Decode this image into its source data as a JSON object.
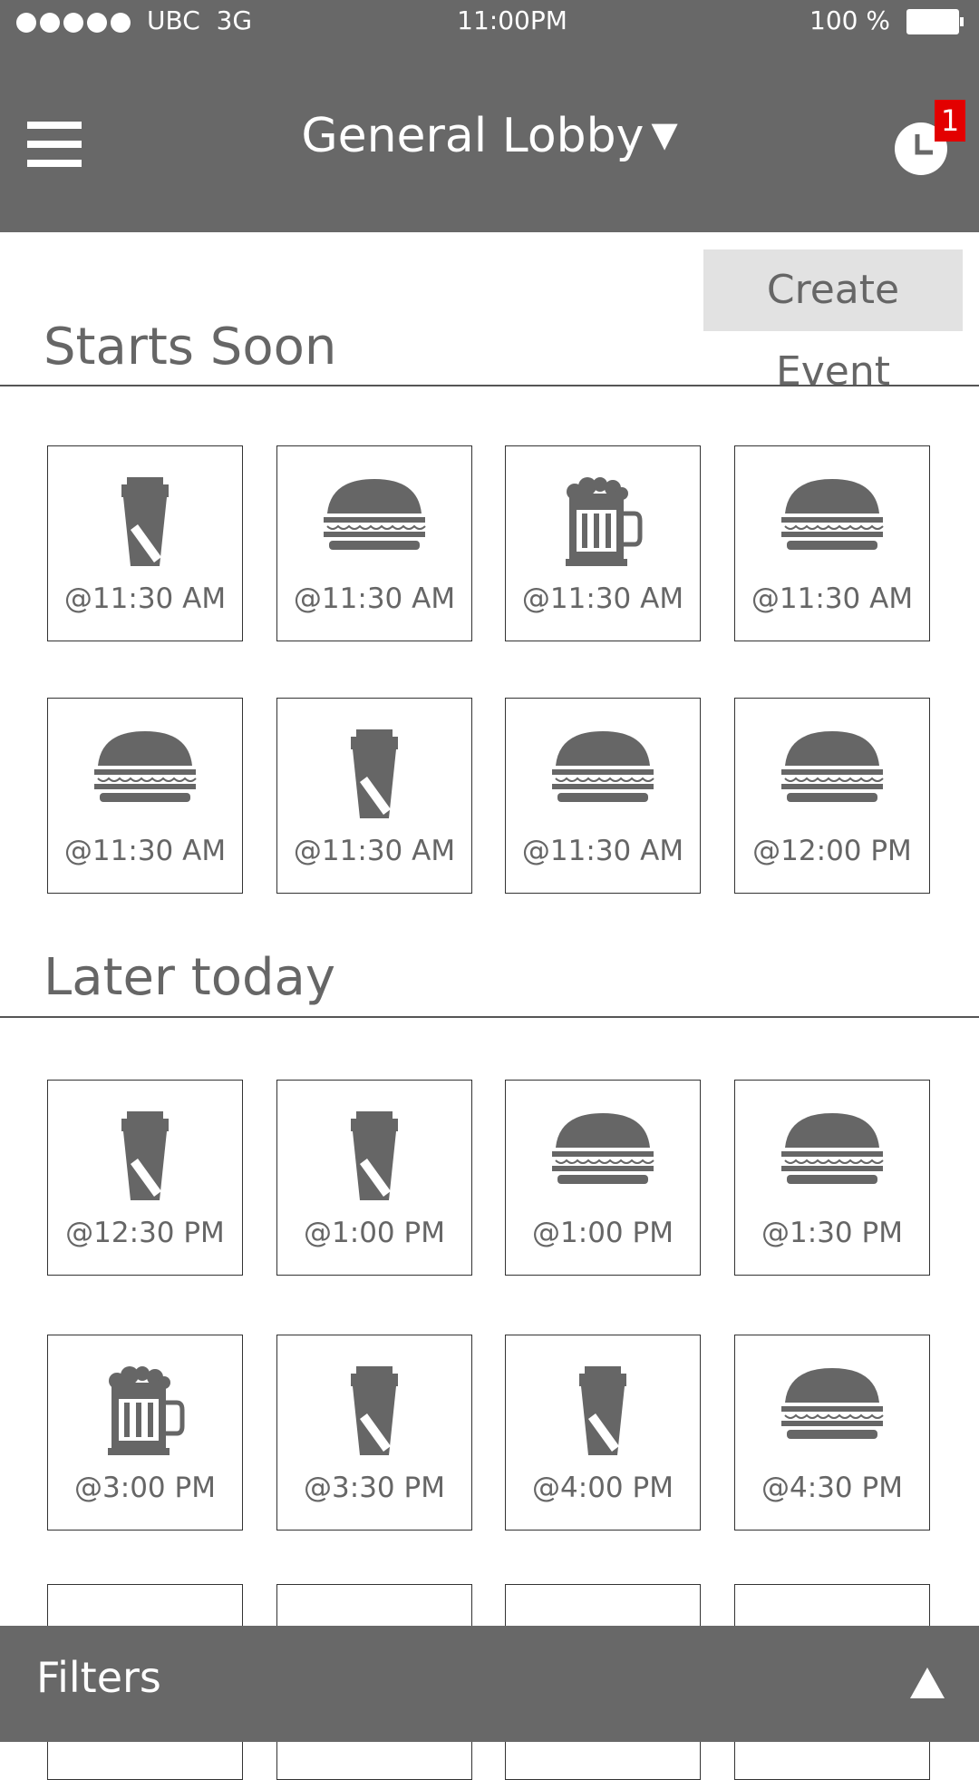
{
  "status_bar": {
    "carrier": "UBC",
    "network": "3G",
    "time": "11:00PM",
    "battery": "100 %"
  },
  "header": {
    "title": "General Lobby",
    "notification_count": "1"
  },
  "create_event_label": "Create Event",
  "sections": [
    {
      "title": "Starts Soon",
      "events": [
        {
          "icon": "coffee-icon",
          "time": "@11:30 AM"
        },
        {
          "icon": "burger-icon",
          "time": "@11:30 AM"
        },
        {
          "icon": "beer-icon",
          "time": "@11:30 AM"
        },
        {
          "icon": "burger-icon",
          "time": "@11:30 AM"
        },
        {
          "icon": "burger-icon",
          "time": "@11:30 AM"
        },
        {
          "icon": "coffee-icon",
          "time": "@11:30 AM"
        },
        {
          "icon": "burger-icon",
          "time": "@11:30 AM"
        },
        {
          "icon": "burger-icon",
          "time": "@12:00 PM"
        }
      ]
    },
    {
      "title": "Later today",
      "events": [
        {
          "icon": "coffee-icon",
          "time": "@12:30 PM"
        },
        {
          "icon": "coffee-icon",
          "time": "@1:00 PM"
        },
        {
          "icon": "burger-icon",
          "time": "@1:00 PM"
        },
        {
          "icon": "burger-icon",
          "time": "@1:30 PM"
        },
        {
          "icon": "beer-icon",
          "time": "@3:00 PM"
        },
        {
          "icon": "coffee-icon",
          "time": "@3:30 PM"
        },
        {
          "icon": "coffee-icon",
          "time": "@4:00 PM"
        },
        {
          "icon": "burger-icon",
          "time": "@4:30 PM"
        },
        {
          "icon": "",
          "time": ""
        },
        {
          "icon": "",
          "time": ""
        },
        {
          "icon": "",
          "time": ""
        },
        {
          "icon": "",
          "time": ""
        }
      ]
    }
  ],
  "filters_label": "Filters",
  "colors": {
    "bar": "#686868",
    "badge": "#e30000",
    "icon": "#666666",
    "button_bg": "#e2e2e2"
  }
}
